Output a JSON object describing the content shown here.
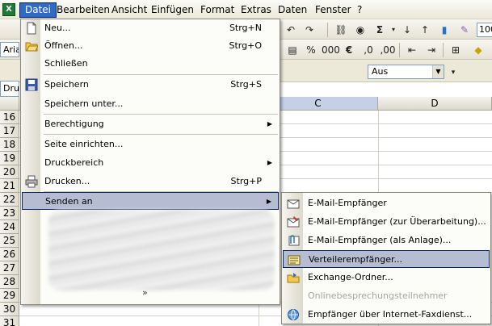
{
  "menubar": {
    "items": [
      {
        "label": "Datei",
        "active": true
      },
      {
        "label": "Bearbeiten"
      },
      {
        "label": "Ansicht"
      },
      {
        "label": "Einfügen"
      },
      {
        "label": "Format"
      },
      {
        "label": "Extras"
      },
      {
        "label": "Daten"
      },
      {
        "label": "Fenster"
      },
      {
        "label": "?"
      }
    ]
  },
  "toolbar": {
    "font_name": "Aria",
    "zoom": "100",
    "percent_symbol": "%",
    "euro_symbol": "€",
    "sigma_symbol": "Σ",
    "filter_value": "Aus",
    "name_box": "Dru"
  },
  "grid": {
    "columns": [
      "C",
      "D"
    ],
    "rows": [
      "16",
      "17",
      "18",
      "19",
      "20",
      "21",
      "22",
      "23",
      "24",
      "25",
      "26",
      "27",
      "28",
      "29",
      "30",
      "31"
    ]
  },
  "file_menu": {
    "items": [
      {
        "label": "Neu...",
        "shortcut": "Strg+N",
        "icon": "new-document-icon"
      },
      {
        "label": "Öffnen...",
        "shortcut": "Strg+O",
        "icon": "open-folder-icon"
      },
      {
        "label": "Schließen",
        "shortcut": ""
      },
      {
        "label": "Speichern",
        "shortcut": "Strg+S",
        "icon": "save-disk-icon"
      },
      {
        "label": "Speichern unter...",
        "shortcut": ""
      },
      {
        "label": "Berechtigung",
        "shortcut": "",
        "submenu": true
      },
      {
        "label": "Seite einrichten...",
        "shortcut": ""
      },
      {
        "label": "Druckbereich",
        "shortcut": "",
        "submenu": true
      },
      {
        "label": "Drucken...",
        "shortcut": "Strg+P",
        "icon": "printer-icon"
      },
      {
        "label": "Senden an",
        "shortcut": "",
        "submenu": true,
        "highlighted": true
      }
    ],
    "expand_glyph": "»"
  },
  "send_submenu": {
    "items": [
      {
        "label": "E-Mail-Empfänger",
        "icon": "mail-icon"
      },
      {
        "label": "E-Mail-Empfänger (zur Überarbeitung)...",
        "icon": "mail-review-icon"
      },
      {
        "label": "E-Mail-Empfänger (als Anlage)...",
        "icon": "attachment-icon"
      },
      {
        "label": "Verteilerempfänger...",
        "icon": "routing-slip-icon",
        "highlighted": true
      },
      {
        "label": "Exchange-Ordner...",
        "icon": "exchange-folder-icon"
      },
      {
        "label": "Onlinebesprechungsteilnehmer",
        "disabled": true
      },
      {
        "label": "Empfänger über Internet-Faxdienst...",
        "icon": "fax-globe-icon"
      }
    ]
  },
  "colors": {
    "menu_highlight": "#b6bdd2",
    "menu_highlight_border": "#0a246a",
    "menubar_active": "#316ac5",
    "disabled_text": "#a7a59c"
  }
}
